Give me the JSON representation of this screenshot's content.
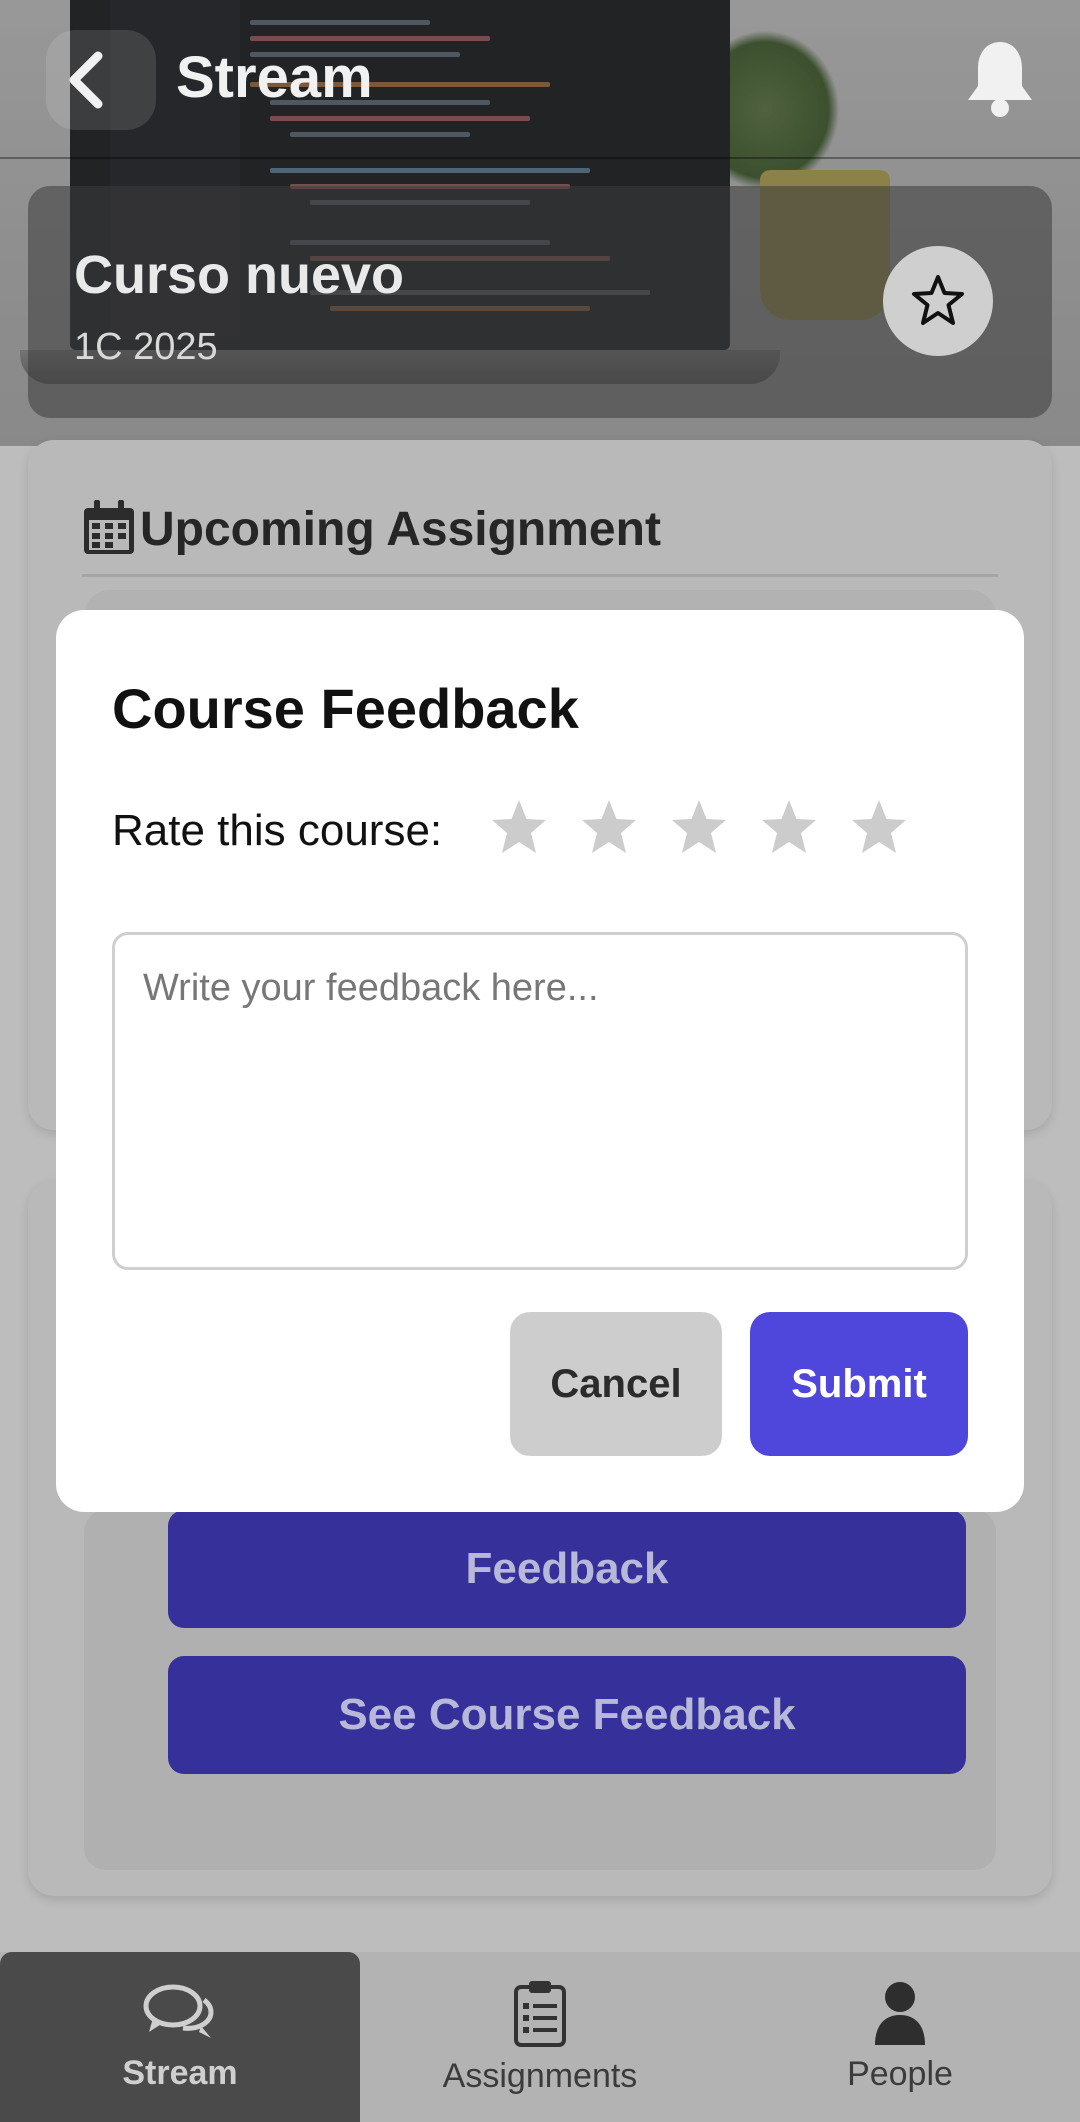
{
  "header": {
    "title": "Stream",
    "back_icon": "chevron-left-icon",
    "bell_icon": "bell-icon"
  },
  "course": {
    "name": "Curso nuevo",
    "term": "1C 2025",
    "favorite_icon": "star-outline-icon"
  },
  "upcoming": {
    "title": "Upcoming Assignment",
    "icon": "calendar-icon"
  },
  "course_actions": {
    "feedback_label": "Feedback",
    "see_feedback_label": "See Course Feedback"
  },
  "bottom_nav": {
    "items": [
      {
        "label": "Stream",
        "icon": "chat-bubbles-icon",
        "active": true
      },
      {
        "label": "Assignments",
        "icon": "clipboard-list-icon",
        "active": false
      },
      {
        "label": "People",
        "icon": "person-icon",
        "active": false
      }
    ]
  },
  "modal": {
    "title": "Course Feedback",
    "rate_label": "Rate this course:",
    "rating": 0,
    "max_rating": 5,
    "feedback_placeholder": "Write your feedback here...",
    "feedback_value": "",
    "cancel_label": "Cancel",
    "submit_label": "Submit"
  },
  "colors": {
    "primary": "#4f46db",
    "star_inactive": "#cccccc",
    "cancel_bg": "#cdcdcd"
  }
}
